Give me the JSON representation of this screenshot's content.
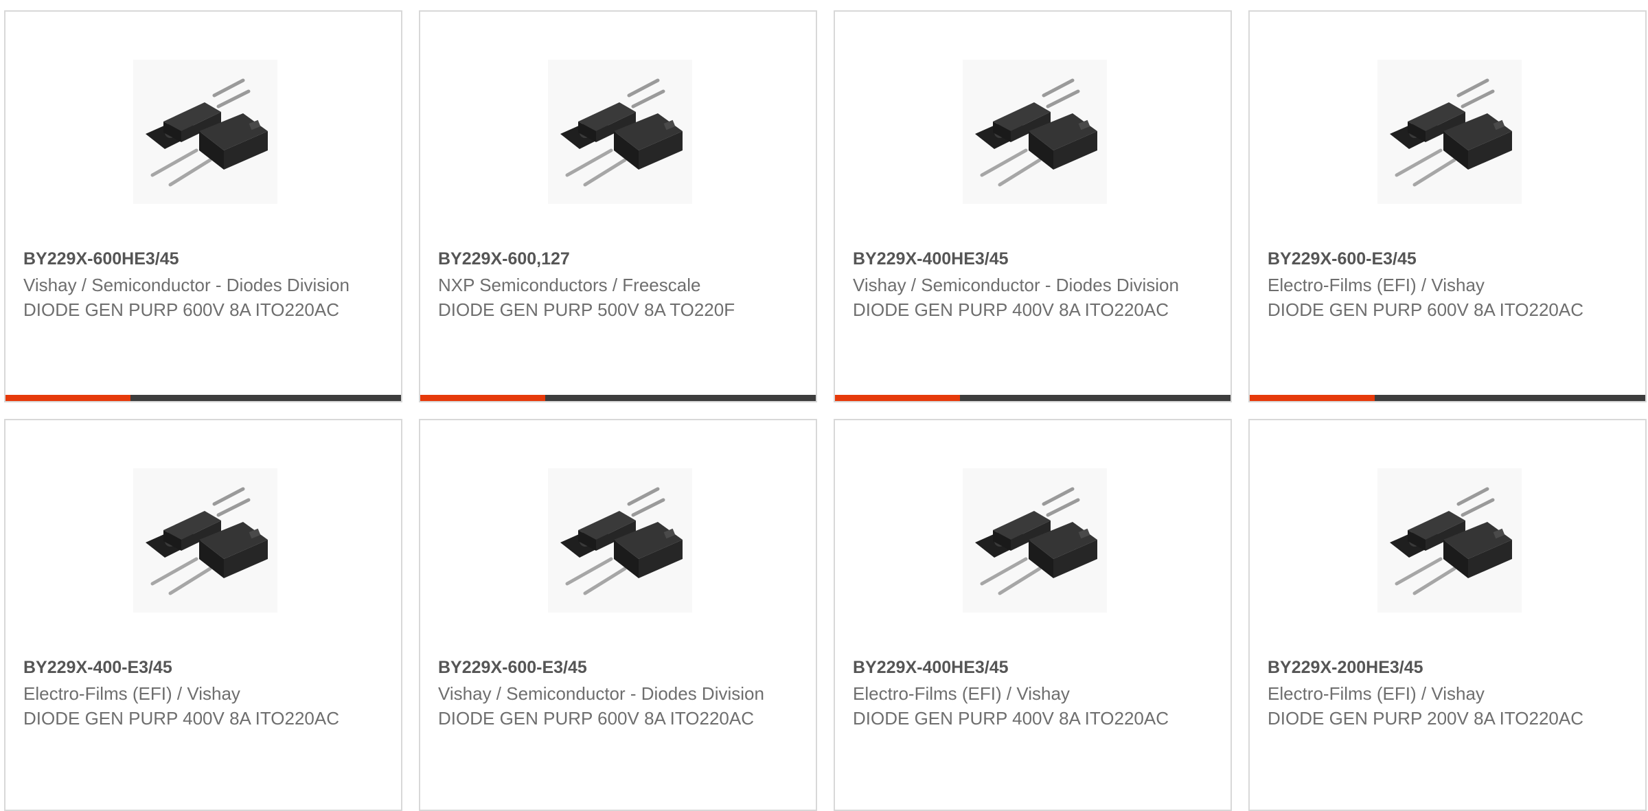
{
  "colors": {
    "accent": "#e63a0b",
    "bar": "#3d3d3d",
    "border": "#d8d8d8",
    "part_text": "#555555",
    "body_text": "#6e6e6e"
  },
  "products": [
    {
      "part": "BY229X-600HE3/45",
      "manufacturer": "Vishay / Semiconductor - Diodes Division",
      "description": "DIODE GEN PURP 600V 8A ITO220AC",
      "image_icon": "to220-diode-package-icon"
    },
    {
      "part": "BY229X-600,127",
      "manufacturer": "NXP Semiconductors / Freescale",
      "description": "DIODE GEN PURP 500V 8A TO220F",
      "image_icon": "to220-diode-package-icon"
    },
    {
      "part": "BY229X-400HE3/45",
      "manufacturer": "Vishay / Semiconductor - Diodes Division",
      "description": "DIODE GEN PURP 400V 8A ITO220AC",
      "image_icon": "to220-diode-package-icon"
    },
    {
      "part": "BY229X-600-E3/45",
      "manufacturer": "Electro-Films (EFI) / Vishay",
      "description": "DIODE GEN PURP 600V 8A ITO220AC",
      "image_icon": "to220-diode-package-icon"
    },
    {
      "part": "BY229X-400-E3/45",
      "manufacturer": "Electro-Films (EFI) / Vishay",
      "description": "DIODE GEN PURP 400V 8A ITO220AC",
      "image_icon": "to220-diode-package-icon"
    },
    {
      "part": "BY229X-600-E3/45",
      "manufacturer": "Vishay / Semiconductor - Diodes Division",
      "description": "DIODE GEN PURP 600V 8A ITO220AC",
      "image_icon": "to220-diode-package-icon"
    },
    {
      "part": "BY229X-400HE3/45",
      "manufacturer": "Electro-Films (EFI) / Vishay",
      "description": "DIODE GEN PURP 400V 8A ITO220AC",
      "image_icon": "to220-diode-package-icon"
    },
    {
      "part": "BY229X-200HE3/45",
      "manufacturer": "Electro-Films (EFI) / Vishay",
      "description": "DIODE GEN PURP 200V 8A ITO220AC",
      "image_icon": "to220-diode-package-icon"
    }
  ]
}
